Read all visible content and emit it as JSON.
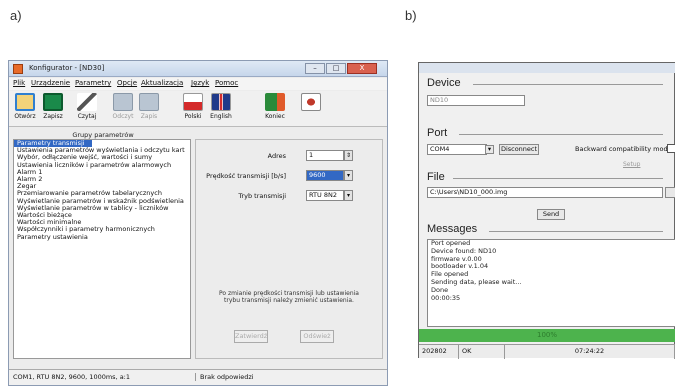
{
  "labels": {
    "a": "a)",
    "b": "b)"
  },
  "windowA": {
    "title": "Konfigurator - [ND30]",
    "controls": {
      "minimize": "–",
      "maximize": "□",
      "close": "X"
    },
    "menu": [
      "Plik",
      "Urządzenie",
      "Parametry",
      "Opcje",
      "Aktualizacja",
      "Język",
      "Pomoc"
    ],
    "toolbar": [
      {
        "label": "Otwórz",
        "icon": "open-icon",
        "color": "#2f7fd0"
      },
      {
        "label": "Zapisz",
        "icon": "save-icon",
        "color": "#1a8a4a"
      },
      {
        "label": "Czytaj",
        "icon": "read-icon",
        "color": "#555555"
      },
      {
        "label": "Odczyt",
        "icon": "read-device-icon",
        "color": "#9aa9b8"
      },
      {
        "label": "Zapis",
        "icon": "write-device-icon",
        "color": "#9aa9b8"
      },
      {
        "label": "Polski",
        "icon": "polish-flag-icon",
        "color": "#d42a2a"
      },
      {
        "label": "English",
        "icon": "uk-flag-icon",
        "color": "#203a8a"
      },
      {
        "label": "Koniec",
        "icon": "exit-icon",
        "color": "#2a8a3a"
      },
      {
        "label": "",
        "icon": "connect-icon",
        "color": "#c0392b"
      }
    ],
    "list_header": "Grupy parametrów",
    "groups": [
      "Parametry transmisji",
      "Ustawienia parametrów wyświetlania i odczytu kart",
      "Wybór, odłączenie wejść, wartości i sumy",
      "Ustawienia liczników i parametrów alarmowych",
      "Alarm 1",
      "Alarm 2",
      "Zegar",
      "Przemiarowanie parametrów tabelarycznych",
      "Wyświetlanie parametrów i wskaźnik podświetlenia",
      "Wyświetlanie parametrów w tablicy - liczników",
      "Wartości bieżące",
      "Wartości minimalne",
      "Współczynniki i parametry harmonicznych",
      "Parametry ustawienia"
    ],
    "fields": [
      {
        "label": "Adres",
        "value": "1"
      },
      {
        "label": "Prędkość transmisji [b/s]",
        "value": "9600"
      },
      {
        "label": "Tryb transmisji",
        "value": "RTU 8N2"
      }
    ],
    "note": "Po zmianie prędkości transmisji lub ustawienia trybu transmisji należy zmienić ustawienia.",
    "buttons": {
      "primary": "Zatwierdź",
      "secondary": "Odśwież"
    },
    "status": {
      "left": "COM1, RTU 8N2, 9600, 1000ms, a:1",
      "right": "Brak odpowiedzi"
    }
  },
  "windowB": {
    "device_label": "Device",
    "device_value": "ND10",
    "port_label": "Port",
    "port_value": "COM4",
    "disconnect_label": "Disconnect",
    "backward_label": "Backward compatibility mode",
    "setup_label": "Setup",
    "file_label": "File",
    "file_value": "C:\\Users\\ND10_000.img",
    "send_label": "Send",
    "messages_label": "Messages",
    "messages": [
      "Port opened",
      "Device found: ND10",
      " firmware v.0.00",
      " bootloader v.1.04",
      "File opened",
      "Sending data, please wait...",
      "Done",
      "00:00:35"
    ],
    "progress": {
      "text": "100%",
      "value": 1.0,
      "color": "#4db34d"
    },
    "status": [
      "202802",
      "OK",
      "07:24:22"
    ]
  }
}
